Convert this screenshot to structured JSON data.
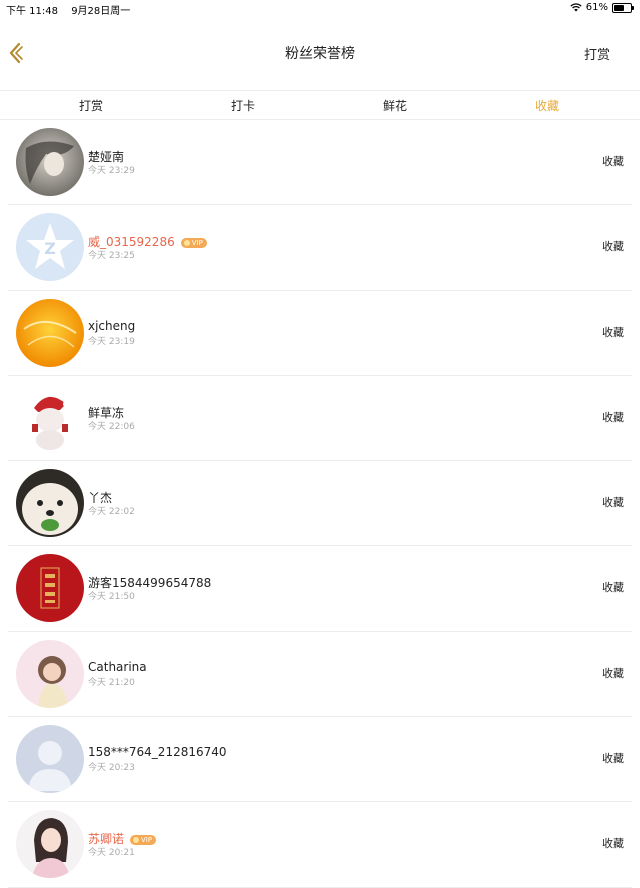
{
  "status_bar": {
    "time": "下午 11:48",
    "date": "9月28日周一",
    "battery": "61%",
    "battery_level": 0.61
  },
  "nav": {
    "title": "粉丝荣誉榜",
    "right_action": "打赏",
    "back_icon": "chevron-left-icon"
  },
  "tabs": [
    {
      "label": "打赏",
      "active": false
    },
    {
      "label": "打卡",
      "active": false
    },
    {
      "label": "鲜花",
      "active": false
    },
    {
      "label": "收藏",
      "active": true
    }
  ],
  "accent_color": "#e8a93a",
  "fans": [
    {
      "name": "楚娅南",
      "time": "今天 23:29",
      "vip": false,
      "action": "收藏"
    },
    {
      "name": "威_031592286",
      "time": "今天 23:25",
      "vip": true,
      "vip_label": "VIP",
      "action": "收藏"
    },
    {
      "name": "xjcheng",
      "time": "今天 23:19",
      "vip": false,
      "action": "收藏"
    },
    {
      "name": "鲜草冻",
      "time": "今天 22:06",
      "vip": false,
      "action": "收藏"
    },
    {
      "name": "丫杰",
      "time": "今天 22:02",
      "vip": false,
      "action": "收藏"
    },
    {
      "name": "游客1584499654788",
      "time": "今天 21:50",
      "vip": false,
      "action": "收藏"
    },
    {
      "name": "Catharina",
      "time": "今天 21:20",
      "vip": false,
      "action": "收藏"
    },
    {
      "name": "158***764_212816740",
      "time": "今天 20:23",
      "vip": false,
      "action": "收藏"
    },
    {
      "name": "苏卿诺",
      "time": "今天 20:21",
      "vip": true,
      "vip_label": "VIP",
      "action": "收藏"
    }
  ]
}
